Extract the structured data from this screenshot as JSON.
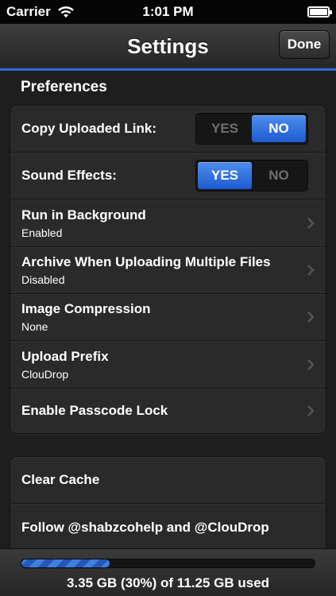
{
  "status_bar": {
    "carrier": "Carrier",
    "time": "1:01 PM"
  },
  "nav": {
    "title": "Settings",
    "done_label": "Done"
  },
  "preferences": {
    "header": "Preferences",
    "copy_uploaded_link": {
      "label": "Copy Uploaded Link:",
      "yes": "YES",
      "no": "NO",
      "value": "NO"
    },
    "sound_effects": {
      "label": "Sound Effects:",
      "yes": "YES",
      "no": "NO",
      "value": "YES"
    },
    "run_in_background": {
      "title": "Run in Background",
      "value": "Enabled"
    },
    "archive_multiple": {
      "title": "Archive When Uploading Multiple Files",
      "value": "Disabled"
    },
    "image_compression": {
      "title": "Image Compression",
      "value": "None"
    },
    "upload_prefix": {
      "title": "Upload Prefix",
      "value": "ClouDrop"
    },
    "passcode_lock": {
      "title": "Enable Passcode Lock"
    }
  },
  "misc": {
    "clear_cache": "Clear Cache",
    "follow": "Follow @shabzcohelp and @ClouDrop"
  },
  "storage": {
    "usage_text": "3.35 GB (30%) of 11.25 GB used",
    "used_fraction": 0.3
  },
  "colors": {
    "accent": "#2d6fd6",
    "toggle_on": "#2f6fdc",
    "background": "#1e1e1e"
  }
}
